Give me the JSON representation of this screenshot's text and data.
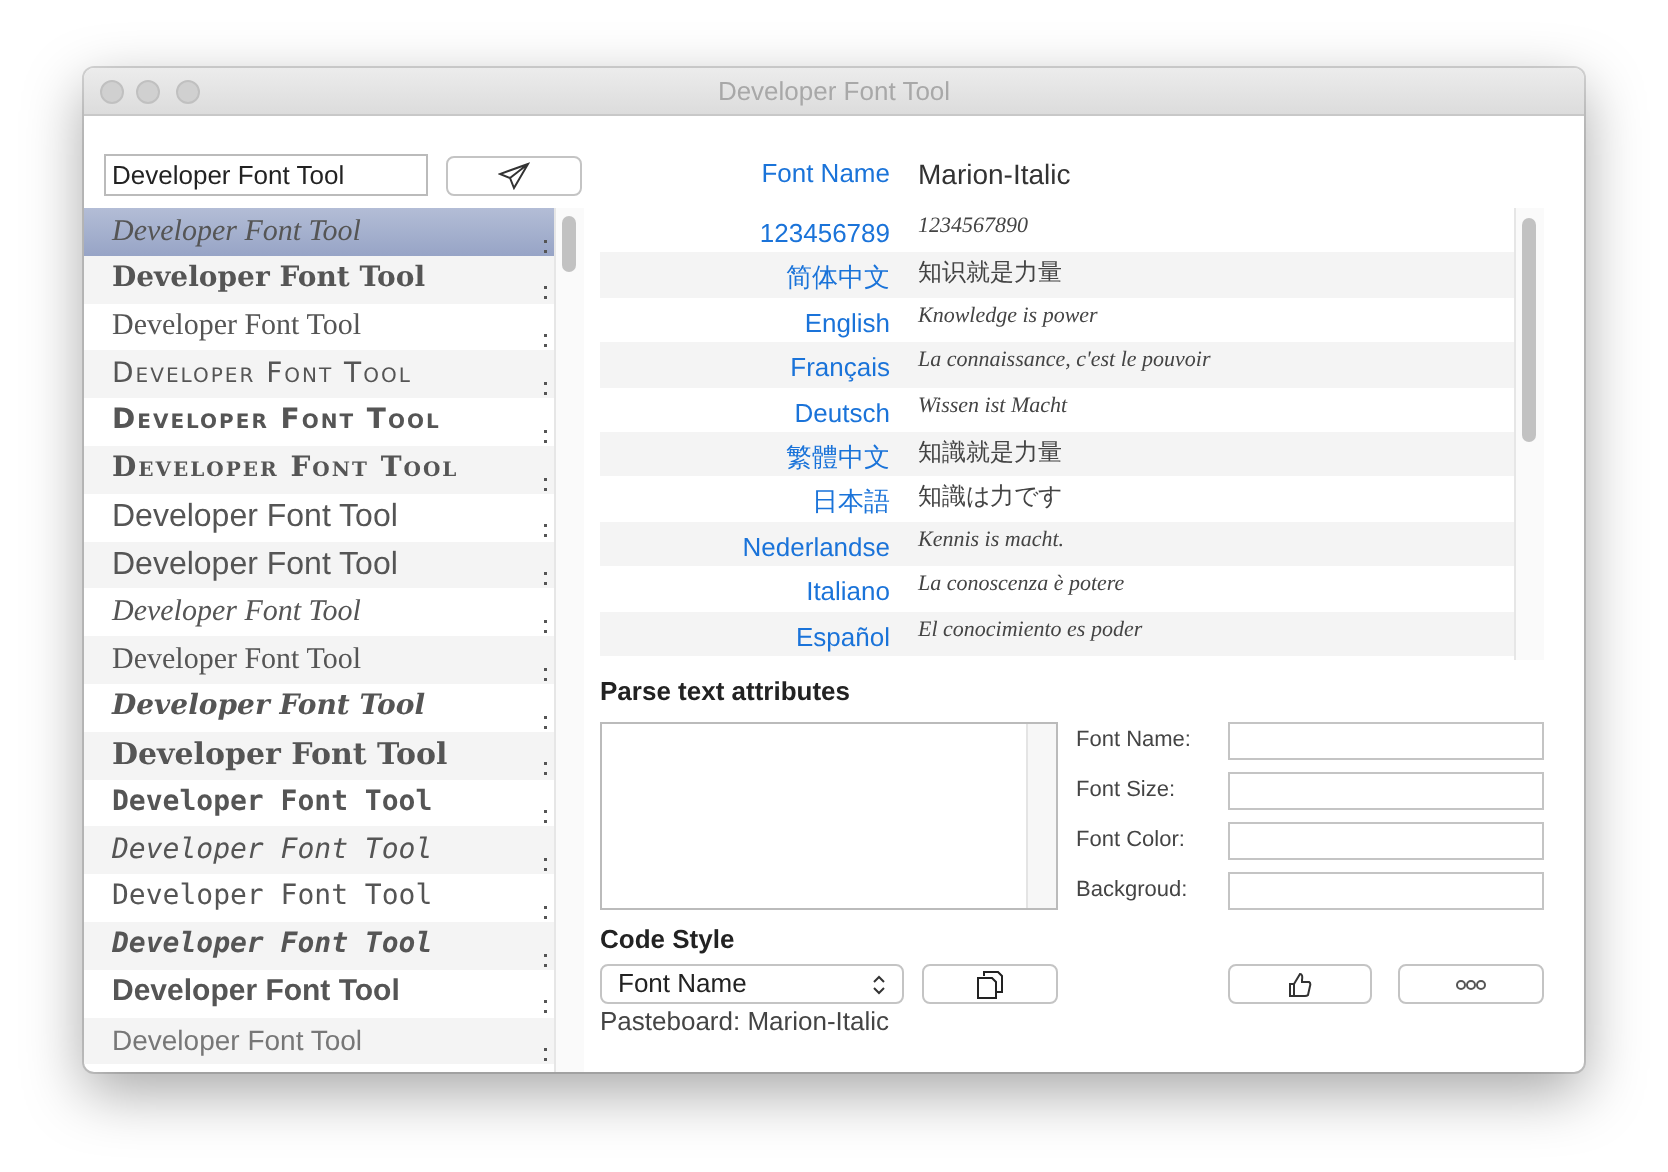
{
  "window": {
    "title": "Developer Font Tool"
  },
  "search": {
    "value": "Developer Font Tool"
  },
  "font_list": [
    {
      "text": "Developer Font Tool",
      "kind": "serif-italic",
      "selected": true
    },
    {
      "text": "Developer Font Tool",
      "kind": "serif-bold",
      "selected": false
    },
    {
      "text": "Developer Font Tool",
      "kind": "serif",
      "selected": false
    },
    {
      "text": "Developer Font Tool",
      "kind": "caps",
      "selected": false
    },
    {
      "text": "Developer Font Tool",
      "kind": "caps-bold",
      "selected": false
    },
    {
      "text": "Developer Font Tool",
      "kind": "caps-heavy",
      "selected": false
    },
    {
      "text": "Developer Font Tool",
      "kind": "sans-light",
      "selected": false
    },
    {
      "text": "Developer Font Tool",
      "kind": "sans-light",
      "selected": false
    },
    {
      "text": "Developer Font Tool",
      "kind": "serif-italic",
      "selected": false
    },
    {
      "text": "Developer Font Tool",
      "kind": "serif",
      "selected": false
    },
    {
      "text": "Developer Font Tool",
      "kind": "serif-bold-italic",
      "selected": false
    },
    {
      "text": "Developer Font Tool",
      "kind": "serif-bold-large",
      "selected": false
    },
    {
      "text": "Developer Font Tool",
      "kind": "mono-bold",
      "selected": false
    },
    {
      "text": "Developer Font Tool",
      "kind": "mono-italic",
      "selected": false
    },
    {
      "text": "Developer Font Tool",
      "kind": "mono",
      "selected": false
    },
    {
      "text": "Developer Font Tool",
      "kind": "mono-bold-italic",
      "selected": false
    },
    {
      "text": "Developer Font Tool",
      "kind": "sans-bold",
      "selected": false
    },
    {
      "text": "Developer Font Tool",
      "kind": "sans-thin",
      "selected": false
    }
  ],
  "font_name": {
    "label": "Font Name",
    "value": "Marion-Italic"
  },
  "samples": [
    {
      "language": "123456789",
      "text": "1234567890",
      "kind": "latin"
    },
    {
      "language": "简体中文",
      "text": "知识就是力量",
      "kind": "cjk"
    },
    {
      "language": "English",
      "text": "Knowledge is power",
      "kind": "latin"
    },
    {
      "language": "Français",
      "text": "La connaissance, c'est le pouvoir",
      "kind": "latin"
    },
    {
      "language": "Deutsch",
      "text": "Wissen ist Macht",
      "kind": "latin"
    },
    {
      "language": "繁體中文",
      "text": "知識就是力量",
      "kind": "cjk"
    },
    {
      "language": "日本語",
      "text": "知識は力です",
      "kind": "cjk"
    },
    {
      "language": "Nederlandse",
      "text": "Kennis is macht.",
      "kind": "latin"
    },
    {
      "language": "Italiano",
      "text": "La conoscenza è potere",
      "kind": "latin"
    },
    {
      "language": "Español",
      "text": "El conocimiento es poder",
      "kind": "latin"
    }
  ],
  "parse": {
    "title": "Parse text attributes",
    "fields": [
      {
        "label": "Font Name:"
      },
      {
        "label": "Font Size:"
      },
      {
        "label": "Font Color:"
      },
      {
        "label": "Backgroud:"
      }
    ]
  },
  "code_style": {
    "title": "Code Style",
    "select": "Font Name",
    "pasteboard": "Pasteboard: Marion-Italic"
  }
}
